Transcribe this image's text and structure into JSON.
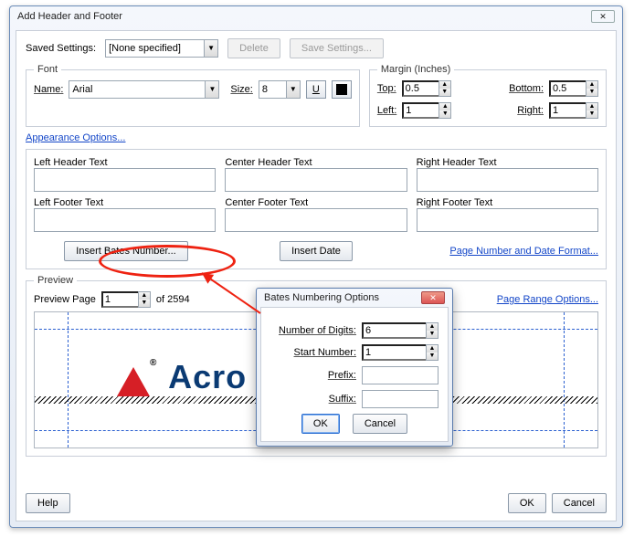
{
  "window": {
    "title": "Add Header and Footer",
    "close_glyph": "✕"
  },
  "saved": {
    "label": "Saved Settings:",
    "value": "[None specified]",
    "delete": "Delete",
    "save": "Save Settings..."
  },
  "font": {
    "legend": "Font",
    "name_label": "Name:",
    "name_value": "Arial",
    "size_label": "Size:",
    "size_value": "8",
    "underline_glyph": "U",
    "color_hex": "#000000"
  },
  "margin": {
    "legend": "Margin (Inches)",
    "top_label": "Top:",
    "top_value": "0.5",
    "bottom_label": "Bottom:",
    "bottom_value": "0.5",
    "left_label": "Left:",
    "left_value": "1",
    "right_label": "Right:",
    "right_value": "1"
  },
  "appearance_link": "Appearance Options...",
  "headers": {
    "lh": "Left Header Text",
    "ch": "Center Header Text",
    "rh": "Right Header Text",
    "lf": "Left Footer Text",
    "cf": "Center Footer Text",
    "rf": "Right Footer Text"
  },
  "buttons": {
    "insert_bates": "Insert Bates Number...",
    "insert_date": "Insert Date",
    "page_format": "Page Number and Date Format..."
  },
  "preview": {
    "legend": "Preview",
    "page_label": "Preview Page",
    "page_value": "1",
    "of_text": "of 2594",
    "range_link": "Page Range Options...",
    "logo_text": "Acro           PI"
  },
  "footer": {
    "help": "Help",
    "ok": "OK",
    "cancel": "Cancel"
  },
  "modal": {
    "title": "Bates Numbering Options",
    "digits_label": "Number of Digits:",
    "digits_value": "6",
    "start_label": "Start Number:",
    "start_value": "1",
    "prefix_label": "Prefix:",
    "prefix_value": "",
    "suffix_label": "Suffix:",
    "suffix_value": "",
    "ok": "OK",
    "cancel": "Cancel"
  }
}
